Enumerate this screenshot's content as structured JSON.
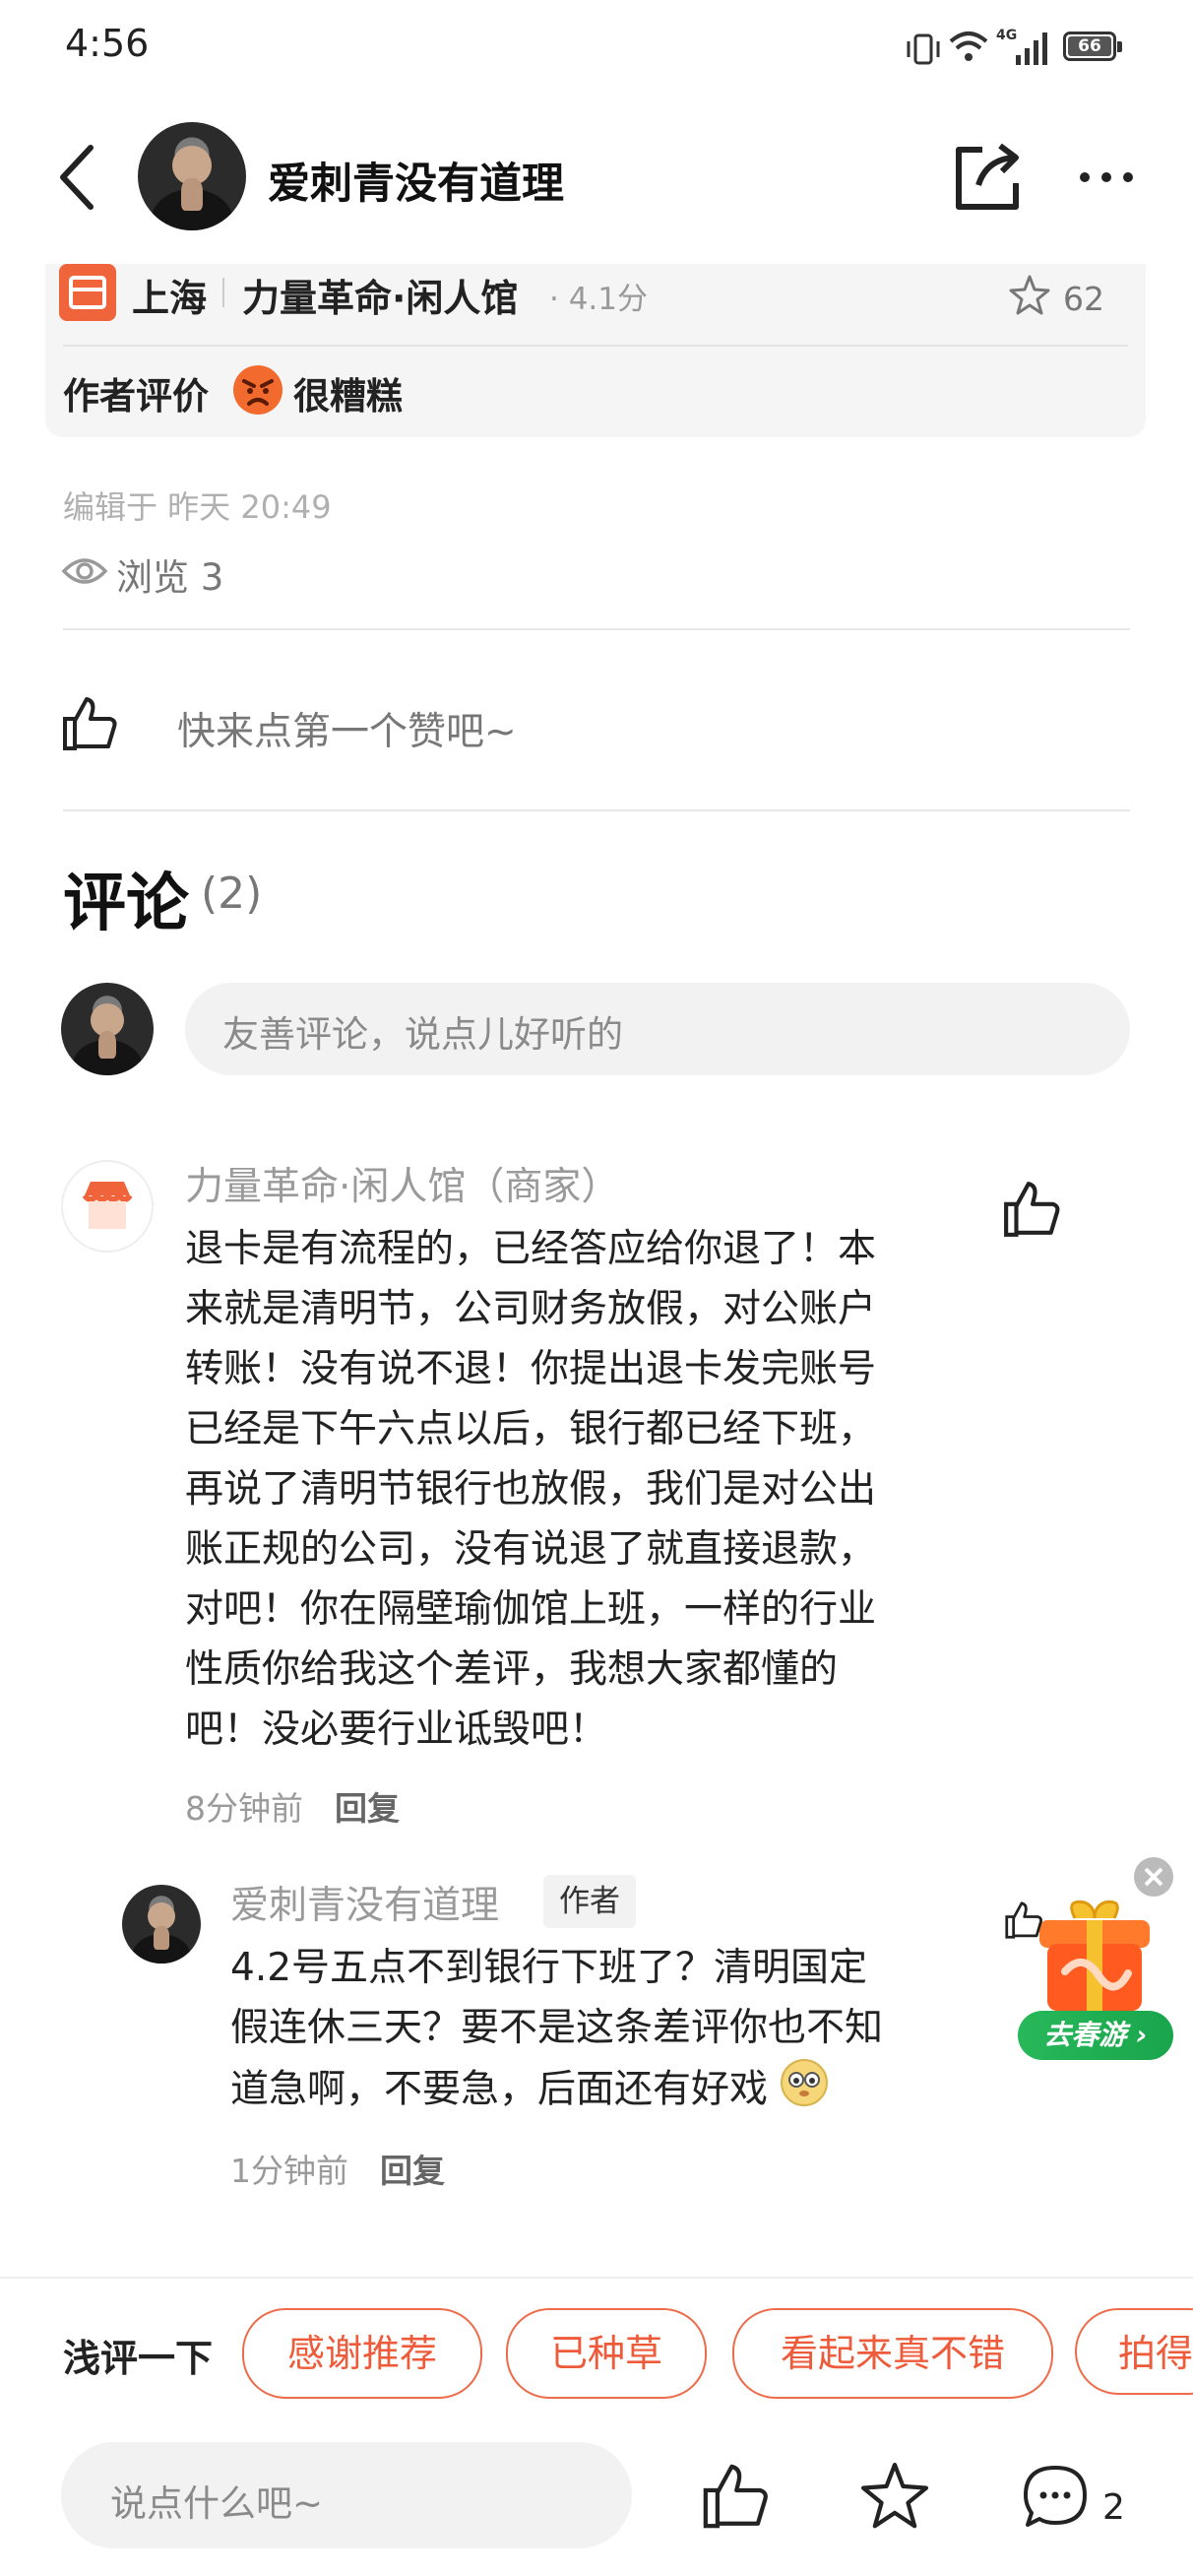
{
  "status_bar": {
    "time": "4:56",
    "battery": "66",
    "network": "4G"
  },
  "header": {
    "title": "爱刺青没有道理",
    "icons": [
      "back-icon",
      "share-icon",
      "more-icon"
    ]
  },
  "shop_card": {
    "city": "上海",
    "shop_name": "力量革命·闲人馆",
    "score": "· 4.1分",
    "favorites": "62",
    "rating_label": "作者评价",
    "rating_value": "很糟糕"
  },
  "meta": {
    "edited": "编辑于 昨天 20:49",
    "views": "浏览 3"
  },
  "like_prompt": "快来点第一个赞吧~",
  "comments_section": {
    "title": "评论",
    "count": "(2)",
    "input_placeholder": "友善评论，说点儿好听的"
  },
  "comments": [
    {
      "author": "力量革命·闲人馆（商家）",
      "lines": [
        "退卡是有流程的，已经答应给你退了！本",
        "来就是清明节，公司财务放假，对公账户",
        "转账！没有说不退！你提出退卡发完账号",
        "已经是下午六点以后，银行都已经下班，",
        "再说了清明节银行也放假，我们是对公出",
        "账正规的公司，没有说退了就直接退款，",
        "对吧！你在隔壁瑜伽馆上班，一样的行业",
        "性质你给我这个差评，我想大家都懂的",
        "吧！没必要行业诋毁吧！"
      ],
      "time": "8分钟前",
      "reply": "回复"
    },
    {
      "author": "爱刺青没有道理",
      "badge": "作者",
      "lines": [
        "4.2号五点不到银行下班了？清明国定",
        "假连休三天？要不是这条差评你也不知",
        "道急啊，不要急，后面还有好戏"
      ],
      "time": "1分钟前",
      "reply": "回复"
    }
  ],
  "promo": {
    "label": "去春游"
  },
  "quick_review": {
    "label": "浅评一下",
    "chips": [
      "感谢推荐",
      "已种草",
      "看起来真不错",
      "拍得"
    ]
  },
  "bottom_bar": {
    "input_placeholder": "说点什么吧~",
    "comment_count": "2"
  },
  "colors": {
    "accent": "#ee5b3a",
    "shop_icon": "#f0643c",
    "card_bg": "#f5f5f5",
    "input_bg": "#f2f2f2"
  }
}
